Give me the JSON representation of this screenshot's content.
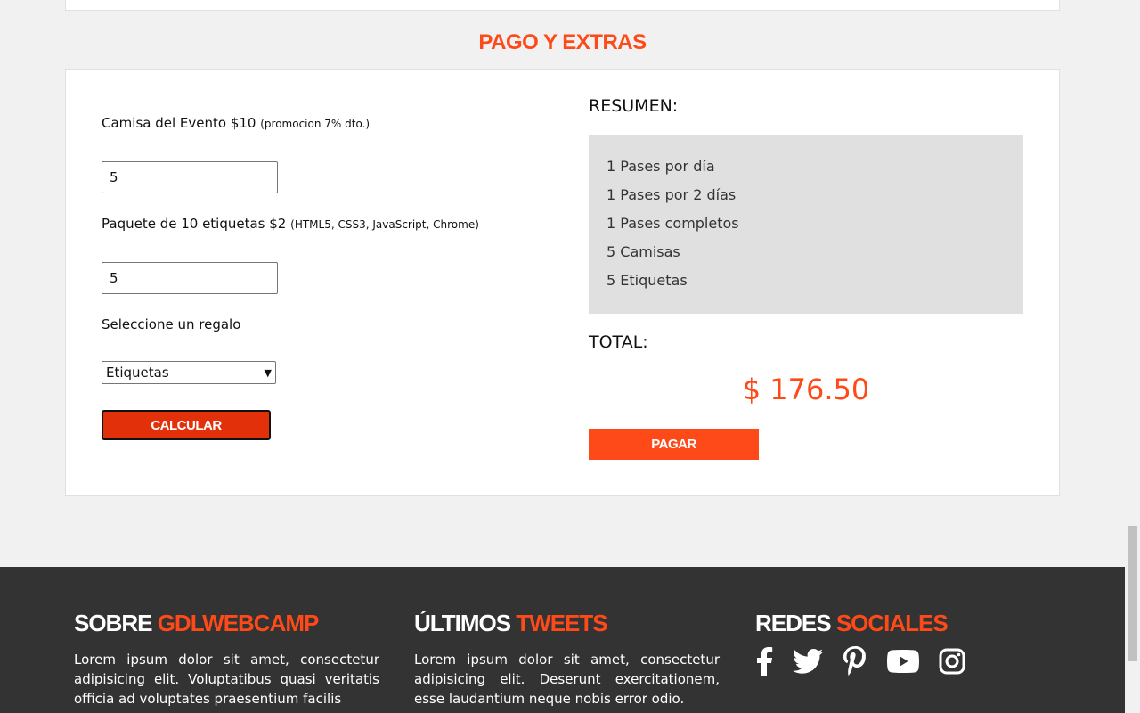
{
  "section": {
    "title": "PAGO Y EXTRAS"
  },
  "extras": {
    "camisa_label": "Camisa del Evento $10",
    "camisa_note": "(promocion 7% dto.)",
    "camisa_value": "5",
    "etiquetas_label": "Paquete de 10 etiquetas $2",
    "etiquetas_note": "(HTML5, CSS3, JavaScript, Chrome)",
    "etiquetas_value": "5",
    "regalo_label": "Seleccione un regalo",
    "regalo_selected": "Etiquetas",
    "calcular_label": "Calcular"
  },
  "resumen": {
    "title": "RESUMEN:",
    "items": [
      "1 Pases por día",
      "1 Pases por 2 días",
      "1 Pases completos",
      "5 Camisas",
      "5 Etiquetas"
    ],
    "total_label": "TOTAL:",
    "total_value": "$ 176.50",
    "pagar_label": "Pagar"
  },
  "footer": {
    "about": {
      "title_a": "SOBRE",
      "title_b": "GDLWEBCAMP",
      "text": "Lorem ipsum dolor sit amet, consectetur adipisicing elit. Voluptatibus quasi veritatis officia ad voluptates praesentium facilis"
    },
    "tweets": {
      "title_a": "ÚLTIMOS",
      "title_b": "TWEETS",
      "text": "Lorem ipsum dolor sit amet, consectetur adipisicing elit. Deserunt exercitationem, esse laudantium neque nobis error odio."
    },
    "social": {
      "title_a": "REDES",
      "title_b": "SOCIALES",
      "icons": [
        "facebook-icon",
        "twitter-icon",
        "pinterest-icon",
        "youtube-icon",
        "instagram-icon"
      ]
    }
  },
  "colors": {
    "accent": "#fe4918",
    "calcular": "#e2300a",
    "footer_bg": "#333333",
    "resumen_bg": "#e0e0e0"
  }
}
